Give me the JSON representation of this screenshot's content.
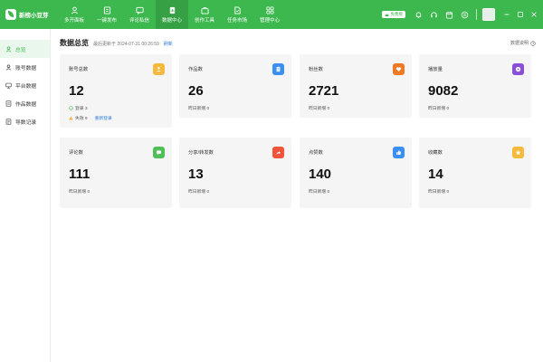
{
  "app": {
    "name": "新榜小豆芽"
  },
  "nav": [
    {
      "id": "multi-open",
      "label": "多开面板",
      "icon": "user-icon"
    },
    {
      "id": "publish",
      "label": "一键发布",
      "icon": "publish-icon"
    },
    {
      "id": "comments",
      "label": "评论私信",
      "icon": "chat-icon"
    },
    {
      "id": "data-center",
      "label": "数据中心",
      "icon": "data-icon",
      "active": true
    },
    {
      "id": "tools",
      "label": "创作工具",
      "icon": "tools-icon"
    },
    {
      "id": "tasks",
      "label": "任务市场",
      "icon": "task-icon"
    },
    {
      "id": "manage",
      "label": "管理中心",
      "icon": "grid-icon"
    }
  ],
  "topright": {
    "tag_label": "免费版"
  },
  "sidebar": [
    {
      "label": "总览",
      "icon": "user-icon",
      "active": true
    },
    {
      "label": "账号数据",
      "icon": "account-icon"
    },
    {
      "label": "平台数据",
      "icon": "platform-icon"
    },
    {
      "label": "作品数据",
      "icon": "works-icon"
    },
    {
      "label": "导数记录",
      "icon": "record-icon"
    }
  ],
  "header": {
    "title": "数据总览",
    "updated": "最后更新于 2024-07-31 00:26:59",
    "refresh": "刷新",
    "help": "数据说明"
  },
  "cards": [
    {
      "label": "账号总数",
      "value": "12",
      "color": "#f5b93b",
      "icon": "person-icon",
      "logged_in": "登录 3",
      "expired": "失效 9",
      "relogin": "重新登录"
    },
    {
      "label": "作品数",
      "value": "26",
      "color": "#3b8ff0",
      "icon": "document-icon",
      "sub": "昨日新增  0"
    },
    {
      "label": "粉丝数",
      "value": "2721",
      "color": "#f07a24",
      "icon": "heart-icon",
      "sub": "昨日新增  0"
    },
    {
      "label": "播放量",
      "value": "9082",
      "color": "#8a4fd8",
      "icon": "play-icon",
      "sub": "昨日新增  0"
    },
    {
      "label": "评论数",
      "value": "111",
      "color": "#4fbf5a",
      "icon": "comment-icon",
      "sub": "昨日新增  0"
    },
    {
      "label": "分享/转发数",
      "value": "13",
      "color": "#f0553a",
      "icon": "share-icon",
      "sub": "昨日新增  0"
    },
    {
      "label": "点赞数",
      "value": "140",
      "color": "#3b8ff0",
      "icon": "thumbs-up-icon",
      "sub": "昨日新增  0"
    },
    {
      "label": "收藏数",
      "value": "14",
      "color": "#f5b93b",
      "icon": "star-icon",
      "sub": "昨日新增  0"
    }
  ]
}
